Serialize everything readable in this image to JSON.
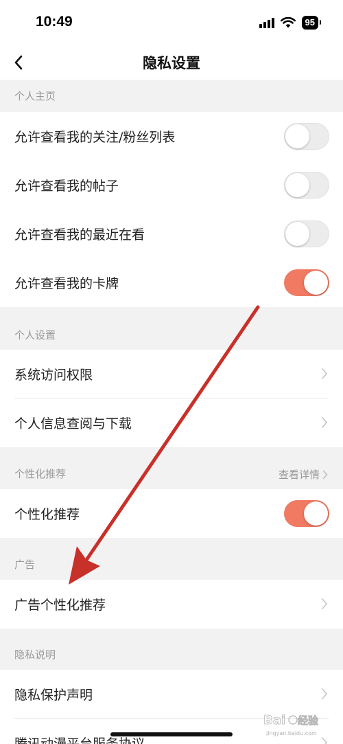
{
  "status_bar": {
    "time": "10:49",
    "battery": "95"
  },
  "nav": {
    "title": "隐私设置"
  },
  "sections": {
    "profile": "个人主页",
    "settings": "个人设置",
    "recommend": "个性化推荐",
    "recommend_detail": "查看详情",
    "ads": "广告",
    "privacy": "隐私说明"
  },
  "rows": {
    "follow_list": "允许查看我的关注/粉丝列表",
    "posts": "允许查看我的帖子",
    "recent": "允许查看我的最近在看",
    "cards": "允许查看我的卡牌",
    "system_permissions": "系统访问权限",
    "personal_info": "个人信息查阅与下载",
    "personalized": "个性化推荐",
    "ad_personalized": "广告个性化推荐",
    "privacy_policy": "隐私保护声明",
    "service_agreement": "腾讯动漫平台服务协议"
  },
  "toggles": {
    "follow_list": false,
    "posts": false,
    "recent": false,
    "cards": true,
    "personalized": true
  },
  "colors": {
    "accent": "#f07a62",
    "arrow": "#c8302a"
  },
  "watermark": {
    "brand": "Bai",
    "brand_mark": "du",
    "suffix": "经验",
    "url": "jingyan.baidu.com"
  }
}
